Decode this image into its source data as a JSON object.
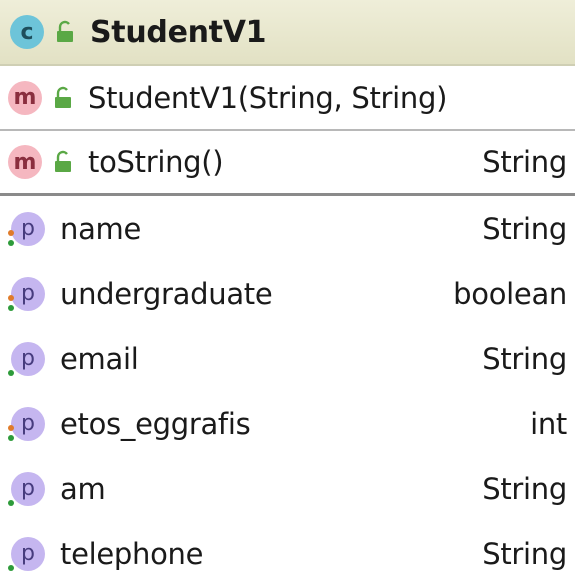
{
  "class": {
    "badge": "c",
    "name": "StudentV1"
  },
  "constructor": {
    "badge": "m",
    "signature": "StudentV1(String, String)"
  },
  "method": {
    "badge": "m",
    "signature": "toString()",
    "return_type": "String"
  },
  "fields": [
    {
      "badge": "p",
      "name": "name",
      "type": "String"
    },
    {
      "badge": "p",
      "name": "undergraduate",
      "type": "boolean"
    },
    {
      "badge": "p",
      "name": "email",
      "type": "String"
    },
    {
      "badge": "p",
      "name": "etos_eggrafis",
      "type": "int"
    },
    {
      "badge": "p",
      "name": "am",
      "type": "String"
    },
    {
      "badge": "p",
      "name": "telephone",
      "type": "String"
    }
  ],
  "colors": {
    "class_badge": "#6dc4d9",
    "method_badge": "#f5b7c0",
    "property_badge": "#c5b6f0",
    "public_lock": "#5aa845",
    "header_bg": "#e2e1c4"
  },
  "icons": {
    "class": "class-c-icon",
    "method": "method-m-icon",
    "property": "property-p-icon",
    "public": "public-lock-icon"
  }
}
